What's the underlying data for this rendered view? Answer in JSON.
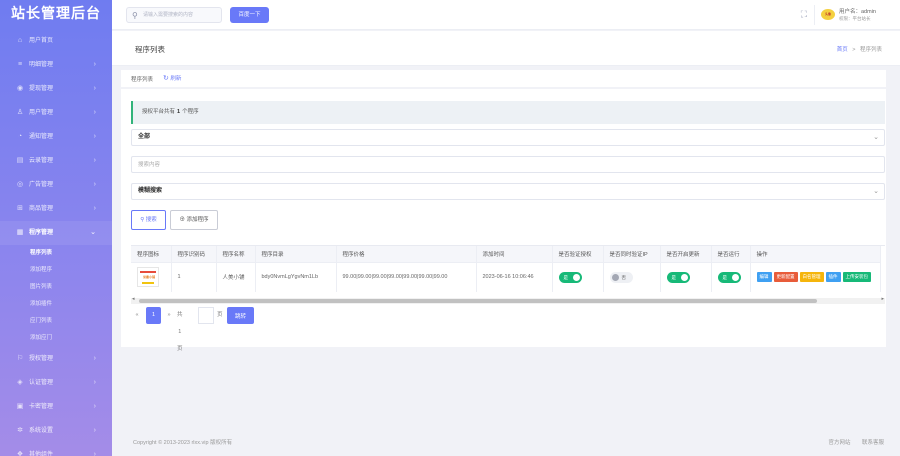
{
  "app": {
    "title": "站长管理后台"
  },
  "topbar": {
    "search_placeholder": "请输入需要搜索的内容",
    "search_button": "百度一下",
    "user_name": "用户名：admin",
    "user_role": "权限：平台站长",
    "avatar_text": "头像"
  },
  "sidebar": {
    "items": [
      {
        "label": "用户首页",
        "icon": "home-icon",
        "glyph": "⌂",
        "chevron": false
      },
      {
        "label": "明细管理",
        "icon": "list-icon",
        "glyph": "≡",
        "chevron": true
      },
      {
        "label": "提现管理",
        "icon": "coin-icon",
        "glyph": "◉",
        "chevron": true
      },
      {
        "label": "用户管理",
        "icon": "user-icon",
        "glyph": "♙",
        "chevron": true
      },
      {
        "label": "通知管理",
        "icon": "bell-icon",
        "glyph": "◔",
        "chevron": true
      },
      {
        "label": "云录管理",
        "icon": "document-icon",
        "glyph": "▤",
        "chevron": true
      },
      {
        "label": "广告管理",
        "icon": "eye-icon",
        "glyph": "◎",
        "chevron": true
      },
      {
        "label": "商品管理",
        "icon": "cart-icon",
        "glyph": "⊞",
        "chevron": true
      },
      {
        "label": "程序管理",
        "icon": "app-icon",
        "glyph": "▦",
        "chevron": true,
        "expanded": true
      }
    ],
    "sub_items": [
      {
        "label": "程序列表",
        "active": true
      },
      {
        "label": "添加程序",
        "active": false
      },
      {
        "label": "图片列表",
        "active": false
      },
      {
        "label": "添加插件",
        "active": false
      },
      {
        "label": "应门列表",
        "active": false
      },
      {
        "label": "添加应门",
        "active": false
      }
    ],
    "items_after": [
      {
        "label": "授权管理",
        "icon": "flag-icon",
        "glyph": "⚐"
      },
      {
        "label": "认证管理",
        "icon": "shield-icon",
        "glyph": "◈"
      },
      {
        "label": "卡密管理",
        "icon": "card-icon",
        "glyph": "▣"
      },
      {
        "label": "系统设置",
        "icon": "gear-icon",
        "glyph": "✲"
      },
      {
        "label": "其他组件",
        "icon": "puzzle-icon",
        "glyph": "❖"
      }
    ]
  },
  "page": {
    "title": "程序列表",
    "breadcrumb_home": "首页",
    "breadcrumb_sep": ">",
    "breadcrumb_current": "程序列表",
    "tab_label": "程序列表",
    "refresh_label": "刷新"
  },
  "filters": {
    "notice_prefix": "授权平台共有",
    "notice_count": "1",
    "notice_suffix": "个程序",
    "status_select": "全部",
    "keyword_placeholder": "搜索内容",
    "search_mode_select": "模糊搜索",
    "search_button": "搜索",
    "add_button": "添加程序"
  },
  "table": {
    "columns": [
      "程序图标",
      "程序识别码",
      "程序名称",
      "程序目录",
      "程序价格",
      "添加时间",
      "是否验证授权",
      "是否同时验证IP",
      "是否开启更新",
      "是否运行",
      "操作"
    ],
    "rows": [
      {
        "icon_text": "米惠小铺",
        "id": "1",
        "name": "人美小铺",
        "dir": "bdy0NvmLgYgvNm1Lb",
        "price": "99.00|99.00|99.00|99.00|99.00|99.00|99.00",
        "time": "2023-06-16 10:06:46",
        "verify": "是",
        "verify_ip": "否",
        "update": "是",
        "running": "是"
      }
    ],
    "actions": [
      {
        "label": "编辑",
        "color": "#3fa0f2"
      },
      {
        "label": "更新配置",
        "color": "#e85c3a"
      },
      {
        "label": "白名管理",
        "color": "#f5b50c"
      },
      {
        "label": "插件",
        "color": "#3fa0f2"
      },
      {
        "label": "上传安装包",
        "color": "#17b978"
      }
    ]
  },
  "pagination": {
    "prev": "«",
    "current": "1",
    "next": "»",
    "total": "共1页",
    "page_unit": "页",
    "go": "跳转"
  },
  "footer": {
    "copyright": "Copyright © 2013-2023 rlxx.vip 版权所有",
    "link1": "官方网站",
    "link2": "联系客服"
  },
  "colors": {
    "accent": "#6979f8",
    "success": "#17b978",
    "sidebar_top": "#6f7cf0",
    "sidebar_bottom": "#a48ce8"
  }
}
